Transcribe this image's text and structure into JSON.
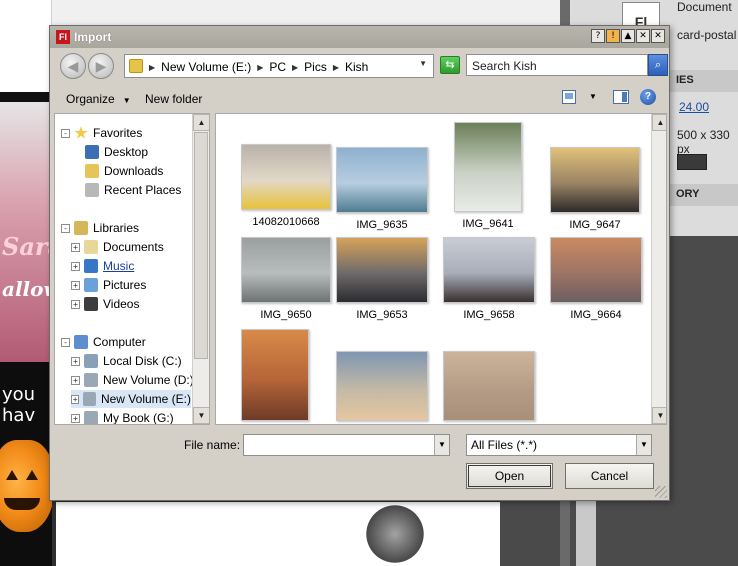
{
  "background": {
    "document_label": "Document",
    "document_name": "card-postal",
    "fl_tile": "Fl",
    "section_properties": "IES",
    "value_link": "24.00",
    "size_text": "500 x 330 px",
    "section_history": "ORY",
    "card_text_1": "Sara",
    "card_text_2": "allowe",
    "card_text_3": "you hav"
  },
  "dialog": {
    "title": "Import",
    "app_icon": "Fl",
    "titlebar_buttons": [
      "?",
      "!",
      "▲",
      "✕",
      "✕"
    ],
    "address": {
      "crumbs": [
        "New Volume (E:)",
        "PC",
        "Pics",
        "Kish"
      ]
    },
    "search": {
      "placeholder": "Search Kish"
    },
    "toolbar": {
      "organize": "Organize",
      "new_folder": "New folder"
    },
    "nav": {
      "favorites": "Favorites",
      "desktop": "Desktop",
      "downloads": "Downloads",
      "recent_places": "Recent Places",
      "libraries": "Libraries",
      "documents": "Documents",
      "music": "Music",
      "pictures": "Pictures",
      "videos": "Videos",
      "computer": "Computer",
      "local_disk": "Local Disk (C:)",
      "new_volume_d": "New Volume (D:)",
      "new_volume_e": "New Volume (E:)",
      "my_book": "My Book (G:)"
    },
    "files": [
      {
        "name": "14082010668",
        "colors": [
          "#b9b2aa",
          "#e2d8c8",
          "#e7c23a"
        ]
      },
      {
        "name": "IMG_9635",
        "colors": [
          "#8fb1cf",
          "#b7cde0",
          "#4f7c90"
        ]
      },
      {
        "name": "IMG_9641",
        "colors": [
          "#6b7f58",
          "#c9d0c4",
          "#e8ece8"
        ]
      },
      {
        "name": "IMG_9647",
        "colors": [
          "#e0c07a",
          "#9a8464",
          "#2c2a2a"
        ]
      },
      {
        "name": "IMG_9650",
        "colors": [
          "#9aa0a0",
          "#b8bcbc",
          "#6d7272"
        ]
      },
      {
        "name": "IMG_9653",
        "colors": [
          "#d5a35a",
          "#6e6a6a",
          "#2b2b30"
        ]
      },
      {
        "name": "IMG_9658",
        "colors": [
          "#c8ccd4",
          "#a8adb8",
          "#3a3030"
        ]
      },
      {
        "name": "IMG_9664",
        "colors": [
          "#c98a62",
          "#9d7464",
          "#6c5e62"
        ]
      },
      {
        "name": "",
        "colors": [
          "#d88a4a",
          "#b56538",
          "#6e3b28"
        ]
      },
      {
        "name": "",
        "colors": [
          "#7f96b2",
          "#c3b9a6",
          "#e6c6a0"
        ]
      },
      {
        "name": "",
        "colors": [
          "#cbb39c",
          "#b49c86",
          "#a88f7a"
        ]
      }
    ],
    "bottom": {
      "file_name_label": "File name:",
      "file_name_value": "",
      "filter": "All Files (*.*)",
      "open_label": "Open",
      "cancel_label": "Cancel"
    }
  }
}
